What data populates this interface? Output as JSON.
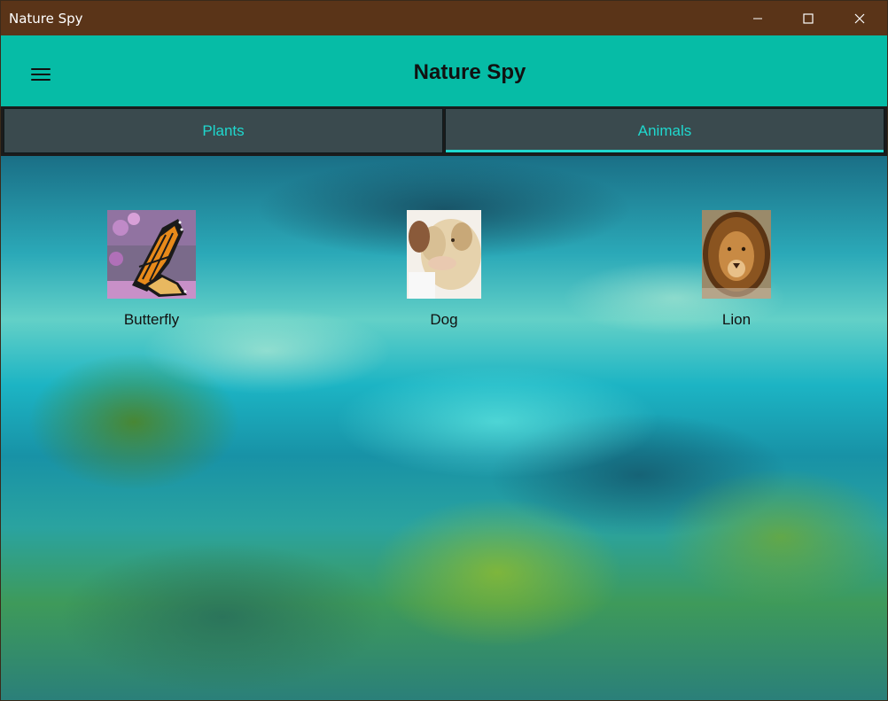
{
  "window": {
    "title": "Nature Spy",
    "controls": [
      "minimize-icon",
      "maximize-icon",
      "close-icon"
    ]
  },
  "appbar": {
    "title": "Nature Spy",
    "menu_icon": "hamburger-menu-icon"
  },
  "tabs": [
    {
      "label": "Plants",
      "active": false
    },
    {
      "label": "Animals",
      "active": true
    }
  ],
  "items": [
    {
      "label": "Butterfly",
      "image": "butterfly-image"
    },
    {
      "label": "Dog",
      "image": "dog-image"
    },
    {
      "label": "Lion",
      "image": "lion-image"
    }
  ],
  "colors": {
    "titlebar": "#5a3418",
    "appbar": "#06bca6",
    "tab_background": "#3a4a4e",
    "tab_text": "#1fd8ce"
  }
}
